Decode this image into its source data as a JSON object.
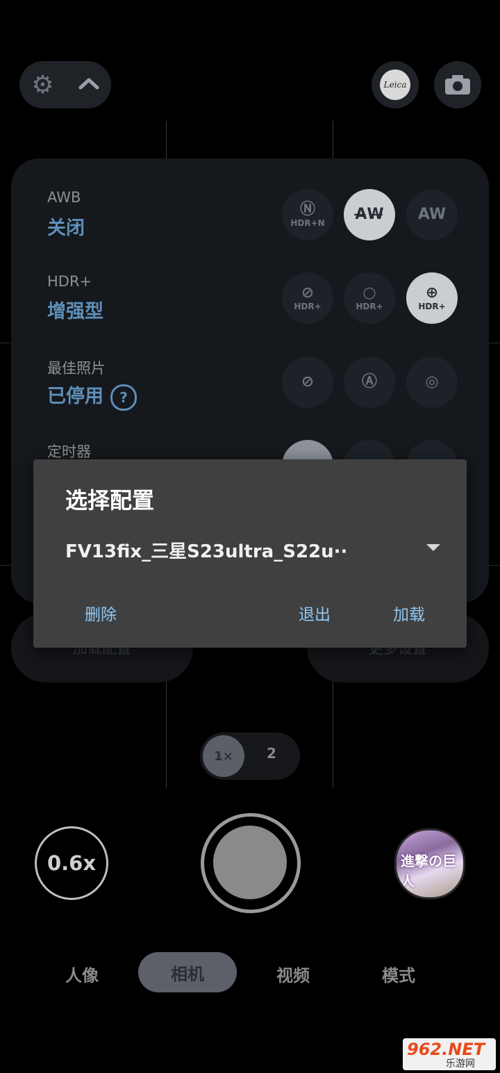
{
  "top_bar": {
    "settings_icon": "gear-icon",
    "expand_icon": "chevron-up-icon",
    "leica_logo_text": "Leica",
    "camera_icon": "camera-icon"
  },
  "settings_panel": {
    "rows": [
      {
        "label": "AWB",
        "value": "关闭",
        "options": [
          {
            "icon": "hdr-night-icon",
            "sym": "Ⓝ",
            "text": "HDR+N"
          },
          {
            "icon": "aw-off-icon",
            "sym": "A̶W̶",
            "text": ""
          },
          {
            "icon": "aw-icon",
            "sym": "AW",
            "text": ""
          }
        ]
      },
      {
        "label": "HDR+",
        "value": "增强型",
        "options": [
          {
            "icon": "hdr-off-icon",
            "sym": "⊘",
            "text": "HDR+"
          },
          {
            "icon": "hdr-icon",
            "sym": "○",
            "text": "HDR+"
          },
          {
            "icon": "hdr-enhanced-icon",
            "sym": "⊕",
            "text": "HDR+"
          }
        ]
      },
      {
        "label": "最佳照片",
        "value": "已停用",
        "help": "?",
        "options": [
          {
            "icon": "best-shot-off-icon",
            "sym": "⊘",
            "text": ""
          },
          {
            "icon": "best-shot-auto-icon",
            "sym": "Ⓐ",
            "text": ""
          },
          {
            "icon": "best-shot-on-icon",
            "sym": "◎",
            "text": ""
          }
        ]
      },
      {
        "label": "定时器",
        "value": "",
        "options": []
      }
    ],
    "load_config_label": "加载配置",
    "more_settings_label": "更多设置"
  },
  "dialog": {
    "title": "选择配置",
    "selected_config": "FV13fix_三星S23ultra_S22u··",
    "delete_label": "删除",
    "exit_label": "退出",
    "load_label": "加载"
  },
  "zoom": {
    "selected": "1×",
    "other": "2"
  },
  "shutter_row": {
    "wide_label": "0.6x",
    "thumbnail_text": "進撃の巨人"
  },
  "modes": {
    "portrait": "人像",
    "camera": "相机",
    "video": "视频",
    "mode": "模式"
  },
  "watermark": {
    "big": "962.NET",
    "small": "乐游网"
  }
}
